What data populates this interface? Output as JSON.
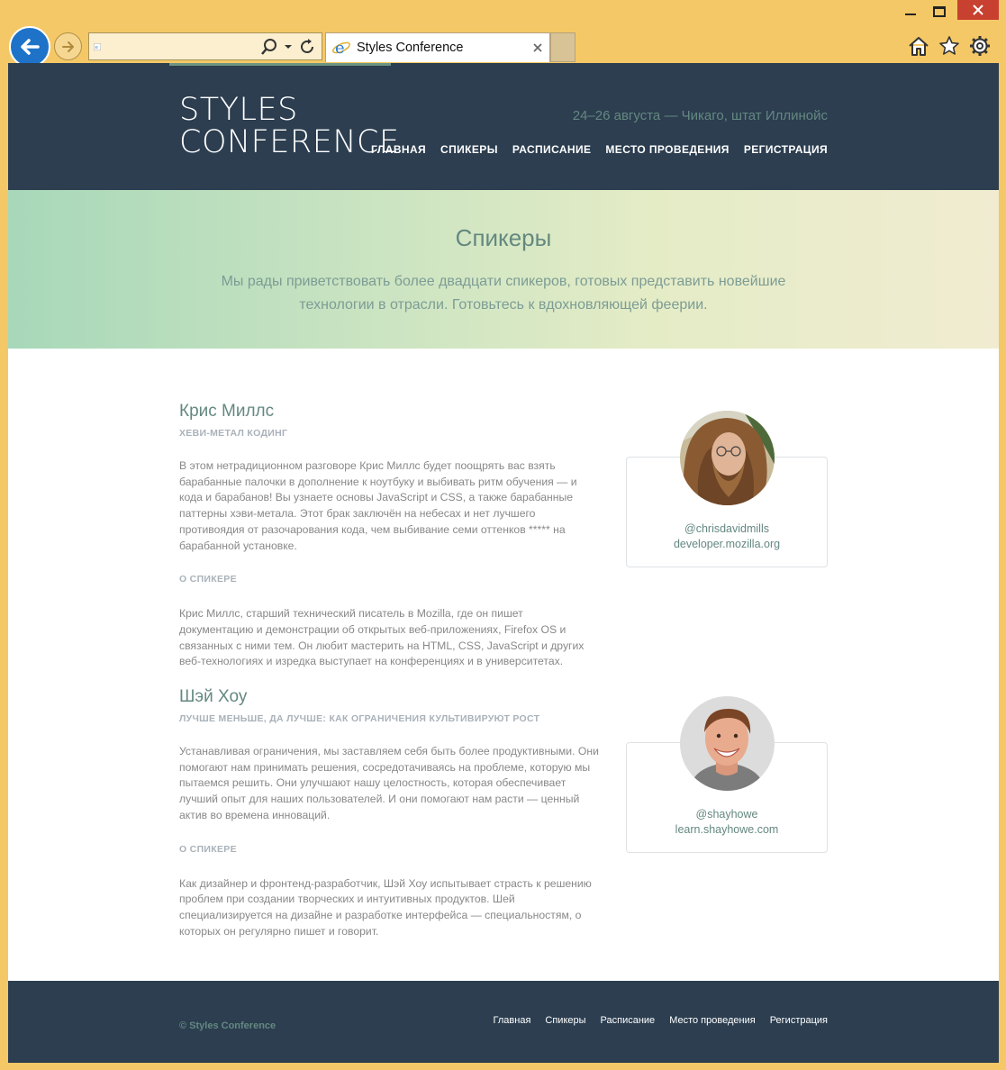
{
  "browser": {
    "tab_title": "Styles Conference",
    "address_value": ""
  },
  "site": {
    "logo_line1": "STYLES",
    "logo_line2": "CONFERENCE",
    "tagline": "24–26 августа — Чикаго, штат Иллинойс",
    "nav": [
      "ГЛАВНАЯ",
      "СПИКЕРЫ",
      "РАСПИСАНИЕ",
      "МЕСТО ПРОВЕДЕНИЯ",
      "РЕГИСТРАЦИЯ"
    ]
  },
  "hero": {
    "title": "Спикеры",
    "lead": "Мы рады приветствовать более двадцати спикеров, готовых представить новейшие технологии в отрасли. Готовьтесь к вдохновляющей феерии."
  },
  "speakers": [
    {
      "name": "Крис Миллс",
      "talk": "ХЕВИ-МЕТАЛ КОДИНГ",
      "description": "В этом нетрадиционном разговоре Крис Миллс будет поощрять вас взять барабанные палочки в дополнение к ноутбуку и выбивать ритм обучения — и кода и барабанов! Вы узнаете основы JavaScript и CSS, а также барабанные паттерны хэви-метала. Этот брак заключён на небесах и нет лучшего противоядия от разочарования кода, чем выбивание семи оттенков ***** на барабанной установке.",
      "about_label": "О СПИКЕРЕ",
      "bio": "Крис Миллс, старший технический писатель в Mozilla, где он пишет документацию и демонстрации об открытых веб-приложениях, Firefox OS и связанных с ними тем. Он любит мастерить на HTML, CSS, JavaScript и других веб-технологиях и изредка выступает на конференциях и в университетах.",
      "handle": "@chrisdavidmills",
      "site": "developer.mozilla.org"
    },
    {
      "name": "Шэй Хоу",
      "talk": "ЛУЧШЕ МЕНЬШЕ, ДА ЛУЧШЕ: КАК ОГРАНИЧЕНИЯ КУЛЬТИВИРУЮТ РОСТ",
      "description": "Устанавливая ограничения, мы заставляем себя быть более продуктивными. Они помогают нам принимать решения, сосредотачиваясь на проблеме, которую мы пытаемся решить. Они улучшают нашу целостность, которая обеспечивает лучший опыт для наших пользователей. И они помогают нам расти — ценный актив во времена инноваций.",
      "about_label": "О СПИКЕРЕ",
      "bio": "Как дизайнер и фронтенд-разработчик, Шэй Хоу испытывает страсть к решению проблем при создании творческих и интуитивных продуктов. Шей специализируется на дизайне и разработке интерфейса — специальностям, о которых он регулярно пишет и говорит.",
      "handle": "@shayhowe",
      "site": "learn.shayhowe.com"
    }
  ],
  "footer": {
    "copyright": "© Styles Conference",
    "nav": [
      "Главная",
      "Спикеры",
      "Расписание",
      "Место проведения",
      "Регистрация"
    ]
  },
  "colors": {
    "header_bg": "#2c3e50",
    "accent": "#648880",
    "window_frame": "#f4c866",
    "back_button": "#1e73c8"
  },
  "icons": [
    "minimize-icon",
    "maximize-icon",
    "close-icon",
    "back-arrow-icon",
    "forward-arrow-icon",
    "ie-favicon-icon",
    "search-icon",
    "chevron-down-icon",
    "refresh-icon",
    "home-icon",
    "star-icon",
    "gear-icon"
  ]
}
